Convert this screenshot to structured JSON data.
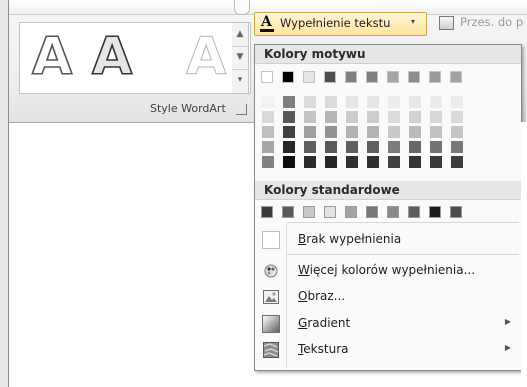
{
  "ribbon": {
    "group_label": "Style WordArt",
    "wordart_letter": "A",
    "fill_button": {
      "label": "Wypełnienie tekstu",
      "arrow": "▾",
      "icon_glyph": "A",
      "icon": "text-fill-icon"
    },
    "shadow_button": {
      "label": "Przes. do p",
      "icon": "send-to-back-icon"
    }
  },
  "menu": {
    "theme_header": "Kolory motywu",
    "standard_header": "Kolory standardowe",
    "theme_top_row": [
      "#ffffff",
      "#000000",
      "#e6e6e6",
      "#4d4d4d",
      "#7f7f7f",
      "#808080",
      "#a5a5a5",
      "#8c8c8c",
      "#9a9a9a",
      "#a0a0a0"
    ],
    "theme_tints": [
      [
        "#f2f2f2",
        "#d9d9d9",
        "#bfbfbf",
        "#a6a6a6",
        "#808080"
      ],
      [
        "#7f7f7f",
        "#595959",
        "#404040",
        "#262626",
        "#0d0d0d"
      ],
      [
        "#dcdcdc",
        "#c4c4c4",
        "#9f9f9f",
        "#5f5f5f",
        "#2b2b2b"
      ],
      [
        "#dbdbdb",
        "#b6b6b6",
        "#929292",
        "#5a5a5a",
        "#262626"
      ],
      [
        "#e5e5e5",
        "#cccccc",
        "#b2b2b2",
        "#5f5f5f",
        "#2f2f2f"
      ],
      [
        "#e6e6e6",
        "#cdcdcd",
        "#b4b4b4",
        "#606060",
        "#303030"
      ],
      [
        "#ededed",
        "#dbdbdb",
        "#c9c9c9",
        "#7b7b7b",
        "#414141"
      ],
      [
        "#e8e8e8",
        "#d1d1d1",
        "#bababa",
        "#686868",
        "#343434"
      ],
      [
        "#ebebeb",
        "#d7d7d7",
        "#c2c2c2",
        "#737373",
        "#393939"
      ],
      [
        "#ececec",
        "#d9d9d9",
        "#c6c6c6",
        "#787878",
        "#3c3c3c"
      ]
    ],
    "standard_colors": [
      "#3a3a3a",
      "#5b5b5b",
      "#c9c9c9",
      "#e2e2e2",
      "#a4a4a4",
      "#777777",
      "#8a8a8a",
      "#5e5e5e",
      "#1c1c1c",
      "#4c4c4c"
    ],
    "items": [
      {
        "label": "Brak wypełnienia",
        "icon": "no-fill-icon",
        "submenu": false
      },
      {
        "label": "Więcej kolorów wypełnienia...",
        "icon": "more-colors-icon",
        "submenu": false
      },
      {
        "label": "Obraz...",
        "icon": "picture-icon",
        "submenu": false
      },
      {
        "label": "Gradient",
        "icon": "gradient-icon",
        "submenu": true
      },
      {
        "label": "Tekstura",
        "icon": "texture-icon",
        "submenu": true
      }
    ],
    "submenu_arrow": "▶"
  }
}
